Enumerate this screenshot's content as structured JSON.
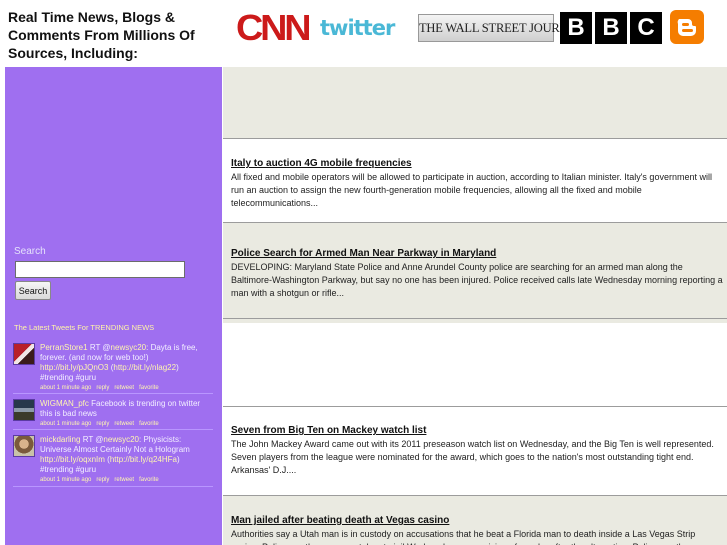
{
  "header": {
    "title": "Real Time News, Blogs & Comments From Millions Of Sources, Including:",
    "logos": {
      "cnn": "CNN",
      "twitter": "twitter",
      "wsj": "THE WALL STREET JOURNAL.",
      "bbc": [
        "B",
        "B",
        "C"
      ]
    }
  },
  "sidebar": {
    "search_label": "Search",
    "search_placeholder": "",
    "search_button": "Search",
    "tweets_heading": "The Latest Tweets For TRENDING NEWS",
    "tweets": [
      {
        "user": "PerranStore1",
        "pre": " RT @",
        "mention": "newsyc20",
        "text": ": Dayta is free, forever. (and now for web too!) ",
        "link1": "http://bit.ly/pJQnO3",
        "mid": " (",
        "link2": "http://bit.ly/nlag22",
        "post": ") #trending #guru",
        "time": "about 1 minute ago",
        "reply": "reply",
        "retweet": "retweet",
        "favorite": "favorite"
      },
      {
        "user": "WIGMAN_pfc",
        "pre": " Facebook is trending on twitter this is bad news",
        "time": "about 1 minute ago",
        "reply": "reply",
        "retweet": "retweet",
        "favorite": "favorite"
      },
      {
        "user": "mickdarling",
        "pre": " RT @",
        "mention": "newsyc20",
        "text": ": Physicists: Universe Almost Certainly Not a Hologram ",
        "link1": "http://bit.ly/oqxnIm",
        "mid": " (",
        "link2": "http://bit.ly/q24HFa",
        "post": ") #trending #guru",
        "time": "about 1 minute ago",
        "reply": "reply",
        "retweet": "retweet",
        "favorite": "favorite"
      }
    ]
  },
  "articles": [
    {
      "title": "Italy to auction 4G mobile frequencies",
      "summary": "All fixed and mobile operators will be allowed to participate in auction, according to Italian minister. Italy's government will run an auction to assign the new fourth-generation mobile frequencies, allowing all the fixed and mobile telecommunications..."
    },
    {
      "title": "Police Search for Armed Man Near Parkway in Maryland",
      "summary": "DEVELOPING: Maryland State Police and Anne Arundel County police are searching for an armed man along the Baltimore-Washington Parkway, but say no one has been injured. Police received calls late Wednesday morning reporting a man with a shotgun or rifle..."
    },
    {
      "title": "Seven from Big Ten on Mackey watch list",
      "summary": "The John Mackey Award came out with its 2011 preseason watch list on Wednesday, and the Big Ten is well represented. Seven players from the league were nominated for the award, which goes to the nation's most outstanding tight end. Arkansas' D.J...."
    },
    {
      "title": "Man jailed after beating death at Vegas casino",
      "summary": "Authorities say a Utah man is in custody on accusations that he beat a Florida man to death inside a Las Vegas Strip casino. Police say the man was taken to jail Wednesday on suspicion of murder after the altercation. Police say the..."
    }
  ],
  "colors": {
    "sidebar_bg": "#9f6ff0",
    "row_bg": "#eaeae1",
    "cnn_red": "#cc1a1a",
    "twitter_blue": "#4ab8d6",
    "blogger_orange": "#f57d00"
  }
}
